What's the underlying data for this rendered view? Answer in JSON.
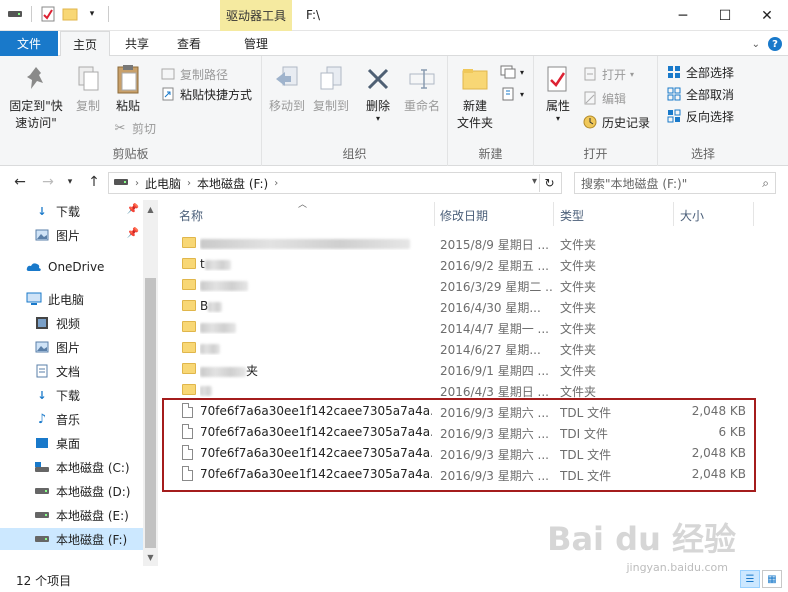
{
  "window": {
    "context_tab": "驱动器工具",
    "title": "F:\\",
    "minimize": "─",
    "maximize": "☐",
    "close": "✕"
  },
  "tabs": {
    "file": "文件",
    "home": "主页",
    "share": "共享",
    "view": "查看",
    "manage": "管理"
  },
  "ribbon": {
    "pin_quick": "固定到\"快",
    "pin_quick2": "速访问\"",
    "copy": "复制",
    "paste": "粘贴",
    "copy_path": "复制路径",
    "paste_shortcut": "粘贴快捷方式",
    "cut": "剪切",
    "clipboard": "剪贴板",
    "move_to": "移动到",
    "copy_to": "复制到",
    "delete": "删除",
    "rename": "重命名",
    "organize": "组织",
    "new_folder": "新建",
    "new_folder2": "文件夹",
    "new": "新建",
    "properties": "属性",
    "open": "打开",
    "edit": "编辑",
    "history": "历史记录",
    "open_group": "打开",
    "select_all": "全部选择",
    "select_none": "全部取消",
    "invert": "反向选择",
    "select_group": "选择"
  },
  "address": {
    "crumbs": [
      "此电脑",
      "本地磁盘 (F:)"
    ],
    "search_placeholder": "搜索\"本地磁盘 (F:)\""
  },
  "nav": {
    "items": [
      {
        "label": "下载",
        "icon": "download-icon",
        "pinned": true
      },
      {
        "label": "图片",
        "icon": "pictures-icon",
        "pinned": true
      },
      {
        "label": "OneDrive",
        "icon": "cloud-icon"
      },
      {
        "label": "此电脑",
        "icon": "computer-icon"
      },
      {
        "label": "视频",
        "icon": "video-icon"
      },
      {
        "label": "图片",
        "icon": "pictures-icon"
      },
      {
        "label": "文档",
        "icon": "document-icon"
      },
      {
        "label": "下载",
        "icon": "download-icon"
      },
      {
        "label": "音乐",
        "icon": "music-icon"
      },
      {
        "label": "桌面",
        "icon": "desktop-icon"
      },
      {
        "label": "本地磁盘 (C:)",
        "icon": "drive-icon"
      },
      {
        "label": "本地磁盘 (D:)",
        "icon": "drive-icon"
      },
      {
        "label": "本地磁盘 (E:)",
        "icon": "drive-icon"
      },
      {
        "label": "本地磁盘 (F:)",
        "icon": "drive-icon"
      }
    ]
  },
  "columns": {
    "name": "名称",
    "date": "修改日期",
    "type": "类型",
    "size": "大小"
  },
  "folders": [
    {
      "name_vis": "",
      "date": "2015/8/9 星期日 ...",
      "type": "文件夹"
    },
    {
      "name_vis": "t",
      "date": "2016/9/2 星期五 ...",
      "type": "文件夹"
    },
    {
      "name_vis": "",
      "date": "2016/3/29 星期二 ...",
      "type": "文件夹"
    },
    {
      "name_vis": "B",
      "date": "2016/4/30 星期...",
      "type": "文件夹"
    },
    {
      "name_vis": "",
      "date": "2014/4/7 星期一 ...",
      "type": "文件夹"
    },
    {
      "name_vis": "",
      "date": "2014/6/27 星期...",
      "type": "文件夹"
    },
    {
      "name_vis": "夹",
      "date": "2016/9/1 星期四 ...",
      "type": "文件夹"
    },
    {
      "name_vis": "",
      "date": "2016/4/3 星期日 ...",
      "type": "文件夹"
    }
  ],
  "files": [
    {
      "name": "70fe6f7a6a30ee1f142caee7305a7a4a....",
      "date": "2016/9/3 星期六 ...",
      "type": "TDL 文件",
      "size": "2,048 KB"
    },
    {
      "name": "70fe6f7a6a30ee1f142caee7305a7a4a....",
      "date": "2016/9/3 星期六 ...",
      "type": "TDI 文件",
      "size": "6 KB"
    },
    {
      "name": "70fe6f7a6a30ee1f142caee7305a7a4a....",
      "date": "2016/9/3 星期六 ...",
      "type": "TDL 文件",
      "size": "2,048 KB"
    },
    {
      "name": "70fe6f7a6a30ee1f142caee7305a7a4a....",
      "date": "2016/9/3 星期六 ...",
      "type": "TDL 文件",
      "size": "2,048 KB"
    }
  ],
  "status": {
    "count": "12 个项目"
  },
  "watermark": {
    "logo": "Bai du 经验",
    "url": "jingyan.baidu.com"
  }
}
